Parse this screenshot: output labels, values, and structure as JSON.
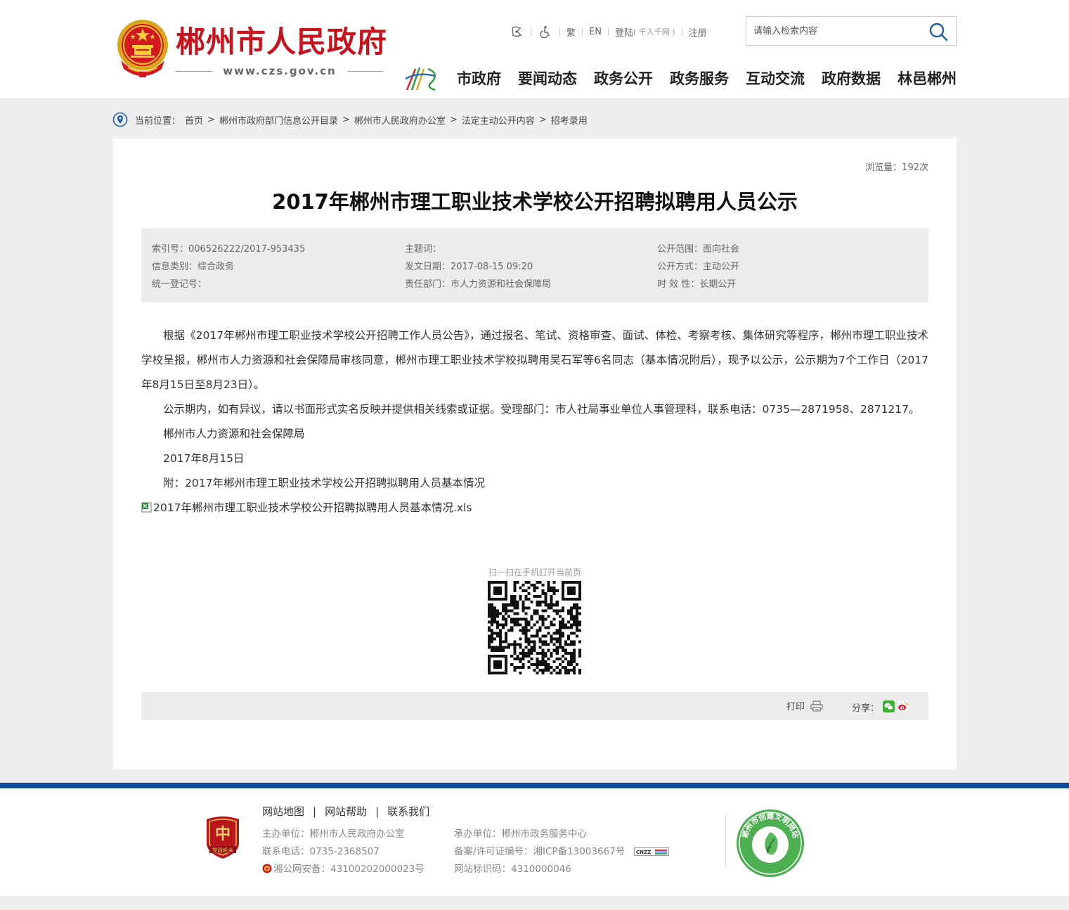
{
  "header": {
    "site_name": "郴州市人民政府",
    "site_domain": "www.czs.gov.cn",
    "toolbar": {
      "traditional": "繁",
      "english": "EN",
      "login": "登陆",
      "login_note": "( 千人千网 )",
      "register": "注册"
    },
    "search": {
      "placeholder": "请输入检索内容"
    },
    "nav": [
      "市政府",
      "要闻动态",
      "政务公开",
      "政务服务",
      "互动交流",
      "政府数据",
      "林邑郴州"
    ]
  },
  "breadcrumb": {
    "label": "当前位置：",
    "items": [
      "首页",
      "郴州市政府部门信息公开目录",
      "郴州市人民政府办公室",
      "法定主动公开内容",
      "招考录用"
    ],
    "separator": ">"
  },
  "article": {
    "views": "浏览量：192次",
    "title": "2017年郴州市理工职业技术学校公开招聘拟聘用人员公示",
    "meta": {
      "index_no": "索引号：006526222/2017-953435",
      "category": "信息类别：综合政务",
      "reg_no": "统一登记号：",
      "subject": "主题词：",
      "date": "发文日期：2017-08-15 09:20",
      "dept": "责任部门：市人力资源和社会保障局",
      "scope": "公开范围：面向社会",
      "method": "公开方式：主动公开",
      "validity": "时 效 性：长期公开"
    },
    "paragraphs": [
      "根据《2017年郴州市理工职业技术学校公开招聘工作人员公告》，通过报名、笔试、资格审查、面试、体检、考察考核、集体研究等程序，郴州市理工职业技术学校呈报，郴州市人力资源和社会保障局审核同意，郴州市理工职业技术学校拟聘用吴石军等6名同志（基本情况附后），现予以公示，公示期为7个工作日（2017年8月15日至8月23日）。",
      "公示期内，如有异议，请以书面形式实名反映并提供相关线索或证据。受理部门：市人社局事业单位人事管理科，联系电话：0735—2871958、2871217。",
      "郴州市人力资源和社会保障局",
      "2017年8月15日",
      "附：2017年郴州市理工职业技术学校公开招聘拟聘用人员基本情况"
    ],
    "attachment": "2017年郴州市理工职业技术学校公开招聘拟聘用人员基本情况.xls",
    "qr_label": "扫一扫在手机打开当前页",
    "print": "打印",
    "share": "分享："
  },
  "footer": {
    "links": [
      "网站地图",
      "网站帮助",
      "联系我们"
    ],
    "link_separator": "|",
    "sponsor": "主办单位：郴州市人民政府办公室",
    "phone": "联系电话：0735-2368507",
    "police": "湘公网安备：43100202000023号",
    "operator": "承办单位：郴州市政务服务中心",
    "icp": "备案/许可证编号：湘ICP备13003667号",
    "site_code": "网站标识码：4310000046",
    "party_badge_text": "党政机关",
    "civil_badge_text": "郴州市创建文明网站",
    "cnzz_text": "CNZZ"
  },
  "colors": {
    "brand_red": "#c8121d",
    "footer_blue": "#0f4c97",
    "meta_bg": "#ececec",
    "page_bg": "#efefef"
  }
}
